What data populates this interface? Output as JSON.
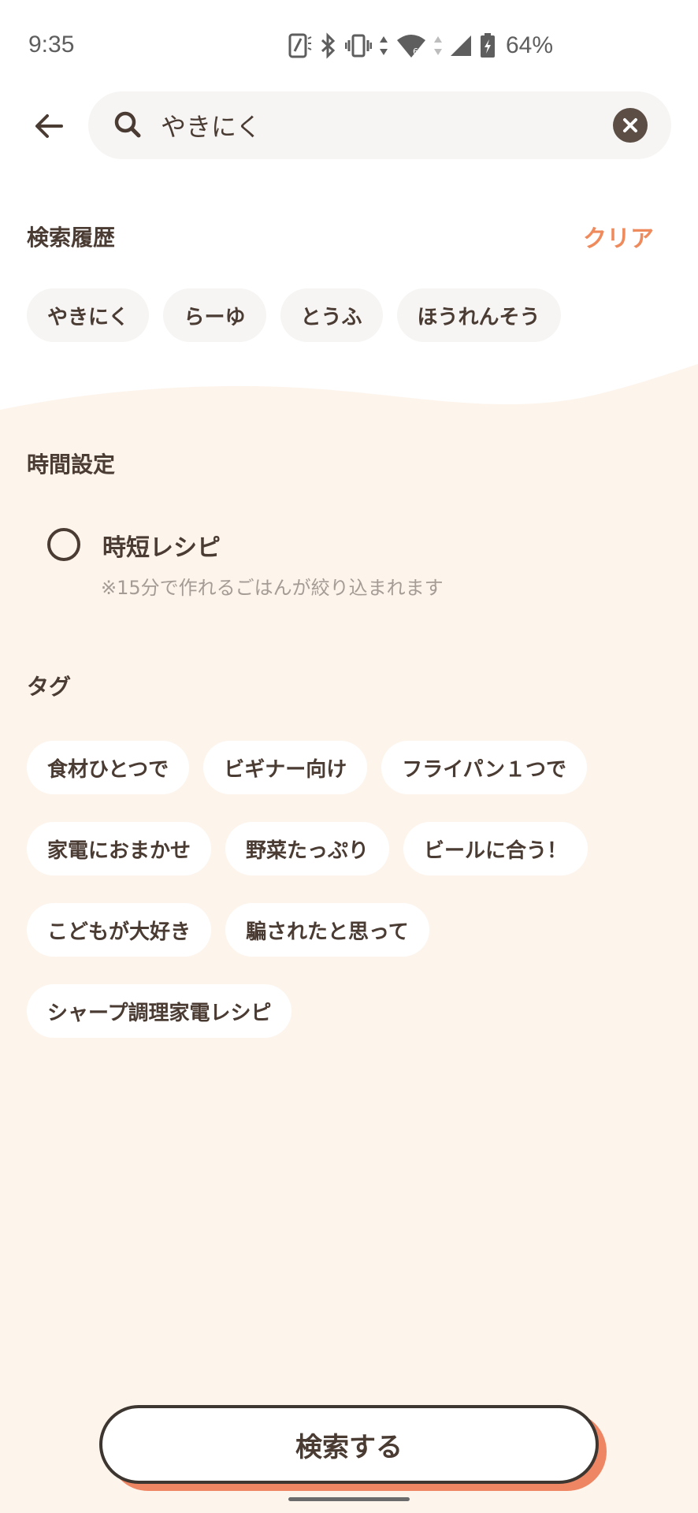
{
  "status_bar": {
    "time": "9:35",
    "battery": "64%",
    "icons": [
      "nfc-icon",
      "bluetooth-icon",
      "vibrate-icon",
      "wifi-icon",
      "signal-icon",
      "battery-icon"
    ]
  },
  "search": {
    "value": "やきにく",
    "placeholder": ""
  },
  "history": {
    "title": "検索履歴",
    "clear_label": "クリア",
    "items": [
      "やきにく",
      "らーゆ",
      "とうふ",
      "ほうれんそう"
    ]
  },
  "time_setting": {
    "title": "時間設定",
    "option_label": "時短レシピ",
    "option_note": "※15分で作れるごはんが絞り込まれます",
    "selected": false
  },
  "tags": {
    "title": "タグ",
    "rows": [
      [
        "食材ひとつで",
        "ビギナー向け",
        "フライパン１つで"
      ],
      [
        "家電におまかせ",
        "野菜たっぷり",
        "ビールに合う！"
      ],
      [
        "こどもが大好き",
        "騙されたと思って"
      ],
      [
        "シャープ調理家電レシピ"
      ]
    ]
  },
  "submit_label": "検索する",
  "colors": {
    "accent": "#ef8a5c",
    "background": "#fdf4ec",
    "text": "#4a3b33"
  }
}
